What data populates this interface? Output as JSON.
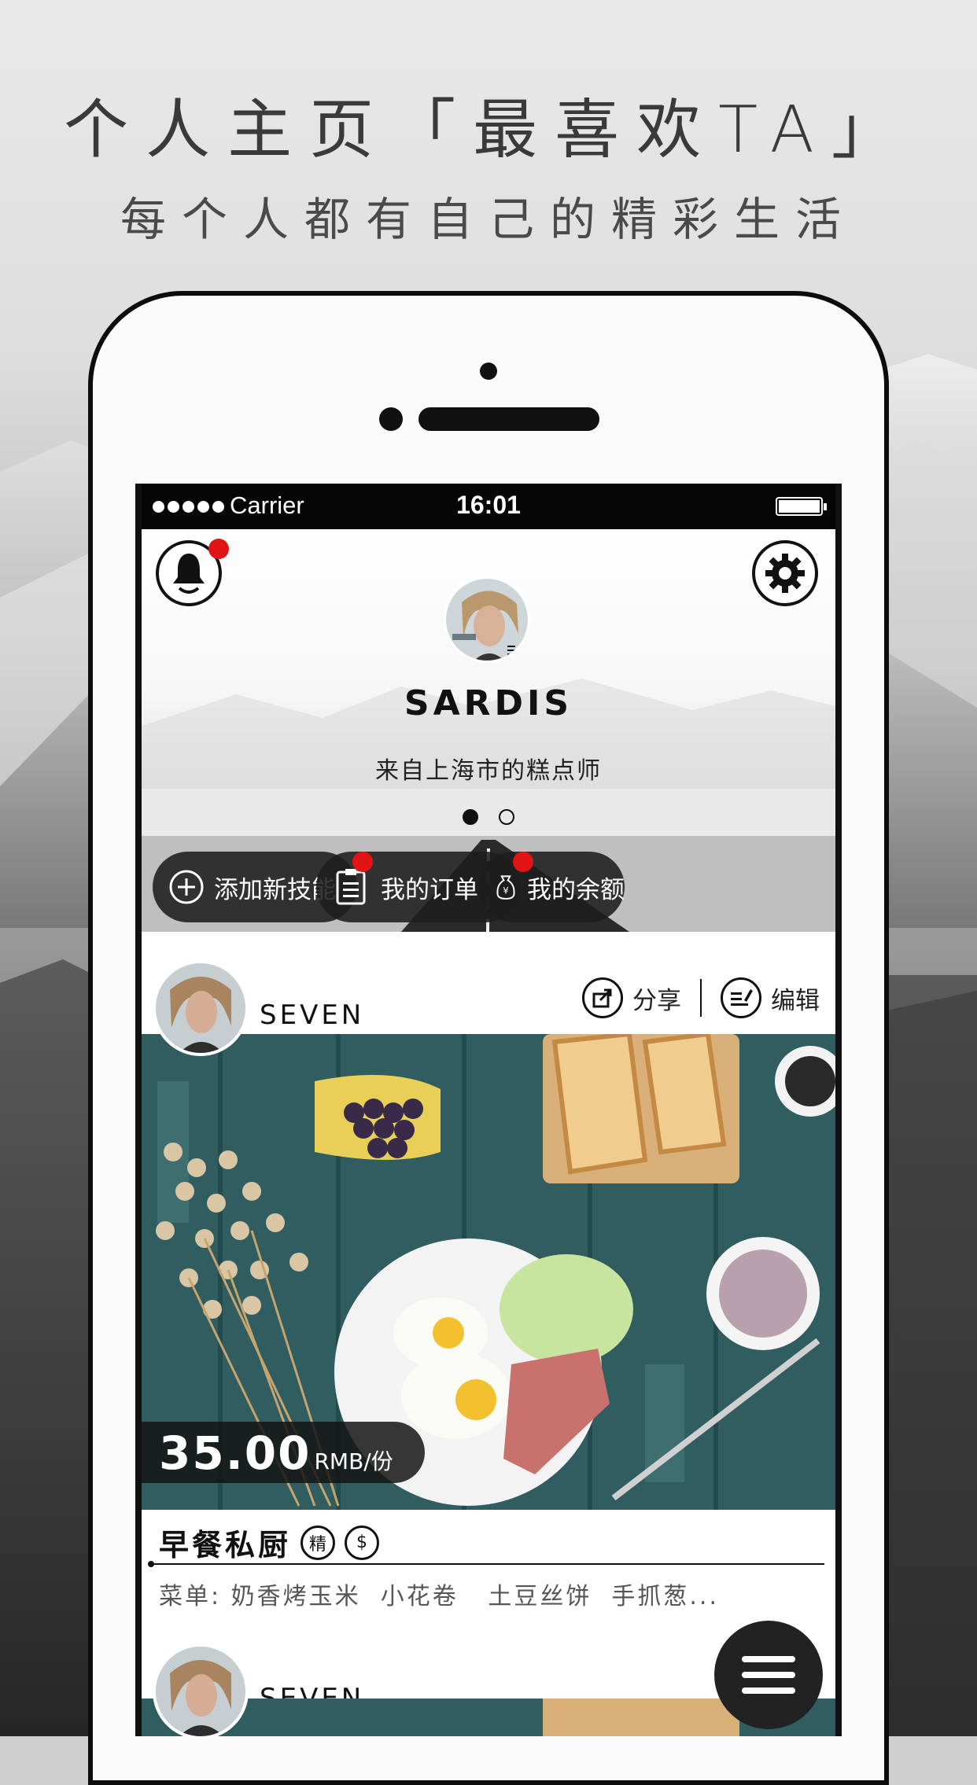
{
  "promo": {
    "title": "个人主页「最喜欢TA」",
    "subtitle": "每个人都有自己的精彩生活"
  },
  "status_bar": {
    "carrier": "Carrier",
    "time": "16:01"
  },
  "profile": {
    "name": "SARDIS",
    "bio": "来自上海市的糕点师",
    "notification_icon": "bell-icon",
    "settings_icon": "gear-icon",
    "pager": {
      "pages": 2,
      "active": 1
    }
  },
  "actions": {
    "add_skill": "添加新技能",
    "my_orders": "我的订单",
    "my_balance": "我的余额"
  },
  "feed": {
    "items": [
      {
        "user": "SEVEN",
        "share_label": "分享",
        "edit_label": "编辑",
        "price_value": "35.00",
        "price_unit": "RMB/份",
        "title": "早餐私厨",
        "badge_featured": "精",
        "badge_money": "$",
        "menu": "菜单: 奶香烤玉米  小花卷   土豆丝饼  手抓葱..."
      },
      {
        "user": "SEVEN"
      }
    ]
  },
  "colors": {
    "accent_red": "#e01414",
    "pill_bg": "#1e1e1e",
    "table_teal": "#2f5d60"
  }
}
